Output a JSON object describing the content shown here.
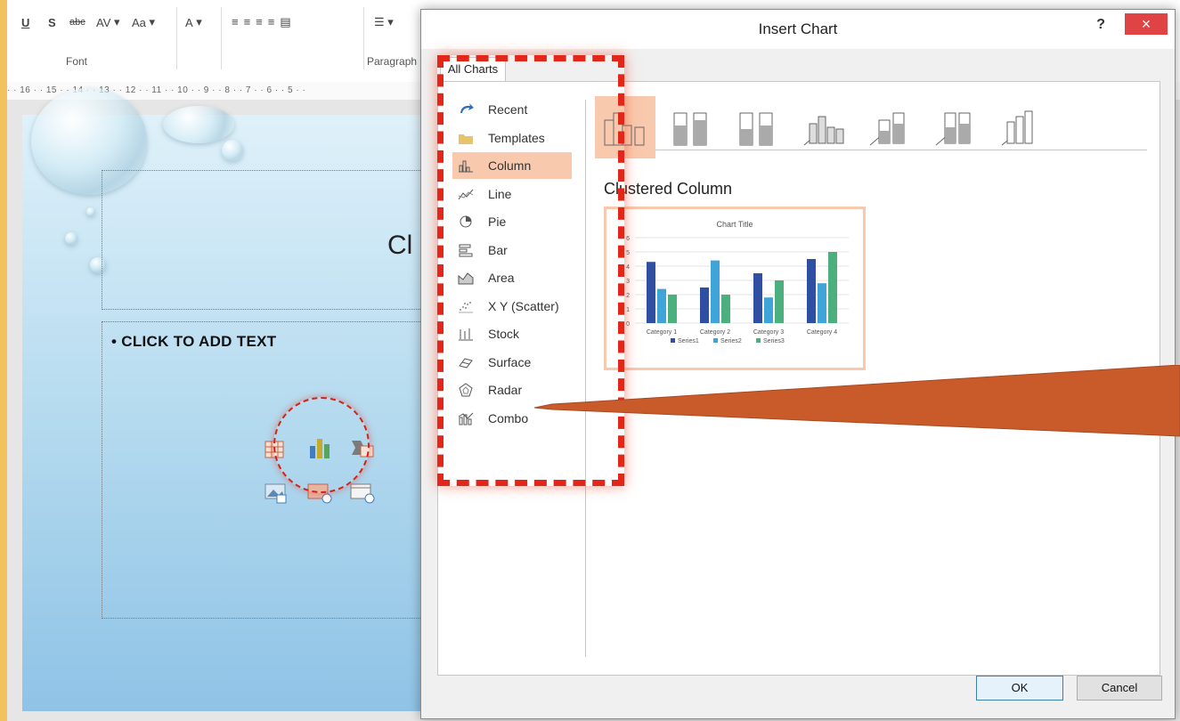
{
  "ribbon": {
    "groups": [
      {
        "label": "Font"
      },
      {
        "label": "Paragraph"
      }
    ],
    "font_controls": [
      "U",
      "S",
      "abc",
      "AV",
      "Aa",
      "A"
    ],
    "ruler_text": "· · 16 · · 15 · · 14 · · 13 · · 12 · · 11 · · 10 · · 9 · · 8 · · 7 · · 6 · · 5 · ·"
  },
  "slide": {
    "title_placeholder": "Cl",
    "body_bullet": "• CLICK TO ADD TEXT"
  },
  "dialog": {
    "title": "Insert Chart",
    "help": "?",
    "close": "×",
    "tab": "All Charts",
    "categories": [
      {
        "label": "Recent",
        "icon": "recent-icon"
      },
      {
        "label": "Templates",
        "icon": "templates-folder-icon"
      },
      {
        "label": "Column",
        "icon": "column-chart-icon",
        "selected": true
      },
      {
        "label": "Line",
        "icon": "line-chart-icon"
      },
      {
        "label": "Pie",
        "icon": "pie-chart-icon"
      },
      {
        "label": "Bar",
        "icon": "bar-chart-icon"
      },
      {
        "label": "Area",
        "icon": "area-chart-icon"
      },
      {
        "label": "X Y (Scatter)",
        "icon": "scatter-chart-icon"
      },
      {
        "label": "Stock",
        "icon": "stock-chart-icon"
      },
      {
        "label": "Surface",
        "icon": "surface-chart-icon"
      },
      {
        "label": "Radar",
        "icon": "radar-chart-icon"
      },
      {
        "label": "Combo",
        "icon": "combo-chart-icon"
      }
    ],
    "subtypes": [
      "clustered-column-icon",
      "stacked-column-icon",
      "100-stacked-column-icon",
      "3d-clustered-column-icon",
      "3d-stacked-column-icon",
      "3d-100-stacked-column-icon",
      "3d-column-icon"
    ],
    "selected_chart_name": "Clustered Column",
    "ok": "OK",
    "cancel": "Cancel"
  },
  "colors": {
    "accent_selection": "#f9c9ad",
    "annotation_red": "#e3261a",
    "series1": "#2f4fa2",
    "series2": "#3fa4d8",
    "series3": "#4cb07e"
  },
  "chart_data": {
    "type": "bar",
    "title": "Chart Title",
    "categories": [
      "Category 1",
      "Category 2",
      "Category 3",
      "Category 4"
    ],
    "series": [
      {
        "name": "Series1",
        "values": [
          4.3,
          2.5,
          3.5,
          4.5
        ]
      },
      {
        "name": "Series2",
        "values": [
          2.4,
          4.4,
          1.8,
          2.8
        ]
      },
      {
        "name": "Series3",
        "values": [
          2,
          2,
          3,
          5
        ]
      }
    ],
    "ylim": [
      0,
      6
    ],
    "yticks": [
      "0",
      "1",
      "2",
      "3",
      "4",
      "5",
      "6"
    ],
    "grid": true,
    "legend": "bottom"
  }
}
